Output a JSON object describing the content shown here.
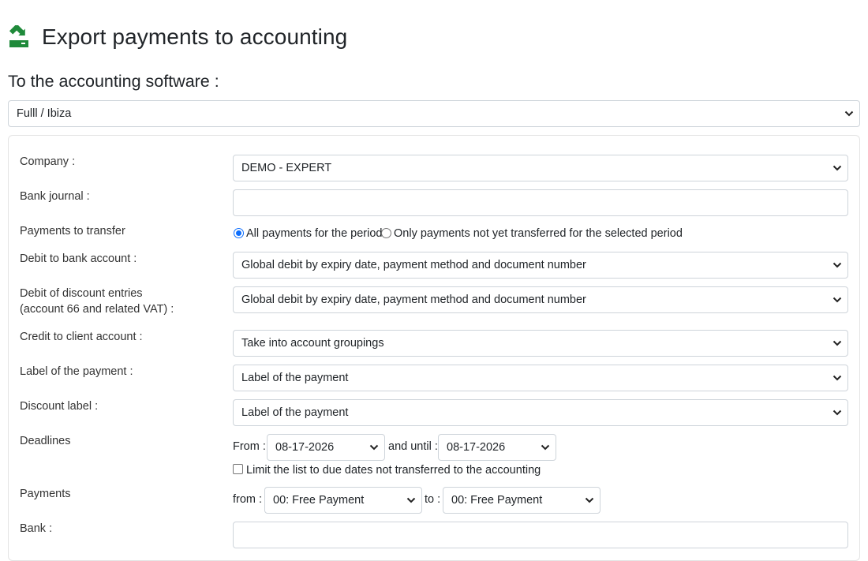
{
  "page": {
    "title": "Export payments to accounting",
    "section_title": "To the accounting software :",
    "software_select": "Fulll / Ibiza"
  },
  "form": {
    "company": {
      "label": "Company :",
      "value": "DEMO - EXPERT"
    },
    "bank_journal": {
      "label": "Bank journal :",
      "value": ""
    },
    "payments_to_transfer": {
      "label": "Payments to transfer",
      "options": [
        "All payments for the period",
        "Only payments not yet transferred for the selected period"
      ],
      "selected": "All payments for the period"
    },
    "debit_bank": {
      "label": "Debit to bank account :",
      "value": "Global debit by expiry date, payment method and document number"
    },
    "debit_discount": {
      "label_line1": "Debit of discount entries",
      "label_line2": "(account 66 and related VAT) :",
      "value": "Global debit by expiry date, payment method and document number"
    },
    "credit_client": {
      "label": "Credit to client account :",
      "value": "Take into account groupings"
    },
    "payment_label": {
      "label": "Label of the payment :",
      "value": "Label of the payment"
    },
    "discount_label": {
      "label": "Discount label :",
      "value": "Label of the payment"
    },
    "deadlines": {
      "label": "Deadlines",
      "from_label": "From :",
      "from_value": "08-17-2026",
      "until_label": "and until :",
      "until_value": "08-17-2026",
      "limit_checkbox": "Limit the list to due dates not transferred to the accounting",
      "limit_checked": false
    },
    "payments": {
      "label": "Payments",
      "from_label": "from :",
      "from_value": "00: Free Payment",
      "to_label": "to :",
      "to_value": "00: Free Payment"
    },
    "bank": {
      "label": "Bank :"
    }
  },
  "colors": {
    "icon_green": "#1f8a3a",
    "accent_blue": "#0d6efd"
  },
  "icons": {
    "page": "export-to-accounting-icon",
    "dropdown": "chevron-down-icon"
  }
}
